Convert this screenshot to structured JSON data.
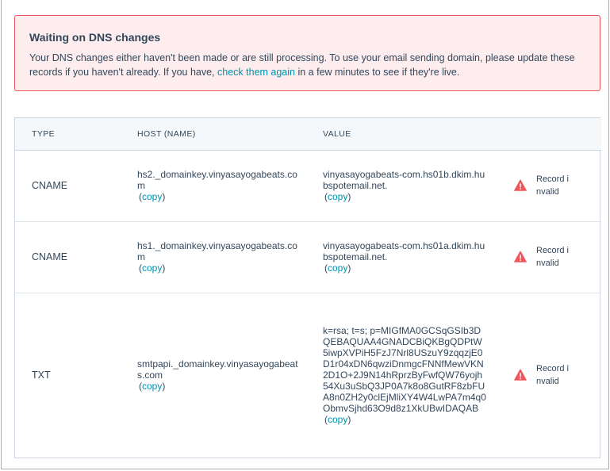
{
  "alert": {
    "title": "Waiting on DNS changes",
    "body_before": "Your DNS changes either haven't been made or are still processing. To use your email sending domain, please update these records if you haven't already. If you have, ",
    "link": "check them again",
    "body_after": " in a few minutes to see if they're live."
  },
  "table": {
    "headers": {
      "type": "TYPE",
      "host": "HOST (NAME)",
      "value": "VALUE"
    },
    "copy_label": "copy",
    "rows": [
      {
        "type": "CNAME",
        "host": "hs2._domainkey.vinyasayogabeats.com",
        "value": "vinyasayogabeats-com.hs01b.dkim.hubspotemail.net.",
        "status": "Record invalid"
      },
      {
        "type": "CNAME",
        "host": "hs1._domainkey.vinyasayogabeats.com",
        "value": "vinyasayogabeats-com.hs01a.dkim.hubspotemail.net.",
        "status": "Record invalid"
      },
      {
        "type": "TXT",
        "host": "smtpapi._domainkey.vinyasayogabeats.com",
        "value": "k=rsa; t=s; p=MIGfMA0GCSqGSIb3DQEBAQUAA4GNADCBiQKBgQDPtW5iwpXVPiH5FzJ7Nrl8USzuY9zqqzjE0D1r04xDN6qwziDnmgcFNNfMewVKN2D1O+2J9N14hRprzByFwfQW76yojh54Xu3uSbQ3JP0A7k8o8GutRF8zbFUA8n0ZH2y0clEjMliXY4W4LwPA7m4q0ObmvSjhd63O9d8z1XkUBwIDAQAB",
        "status": "Record invalid"
      }
    ]
  },
  "colors": {
    "alert_bg": "#fdedee",
    "alert_border": "#f2545b",
    "link": "#0091ae",
    "warning": "#f2545b"
  },
  "icons": {
    "status": "warning-triangle-icon"
  }
}
